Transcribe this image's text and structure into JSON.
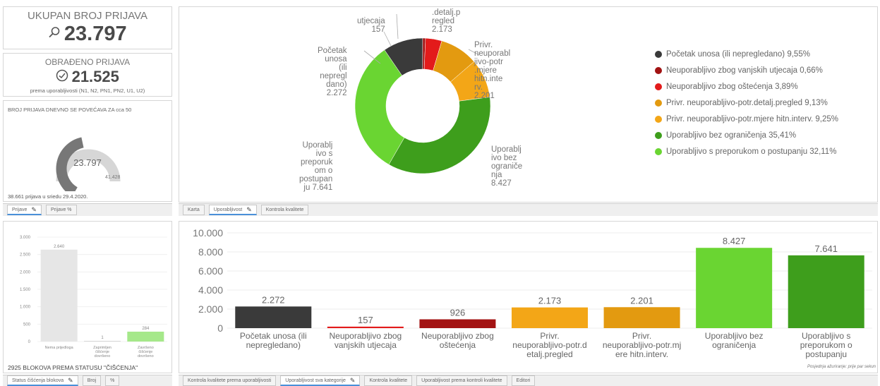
{
  "kpi_total": {
    "title": "UKUPAN BROJ PRIJAVA",
    "value": "23.797",
    "icon": "search-icon"
  },
  "kpi_processed": {
    "title": "OBRAĐENO PRIJAVA",
    "value": "21.525",
    "subtitle": "prema uporabljivosti (N1, N2, PN1, PN2, U1, U2)",
    "icon": "check-circle-icon"
  },
  "gauge": {
    "title": "BROJ PRIJAVA DNEVNO SE POVEĆAVA ZA cca 50",
    "value": "23.797",
    "min": "0",
    "max": "41.428",
    "fraction": 0.574,
    "footer": "38.661 prijava u sriedu 29.4.2020."
  },
  "tabs_left_top": [
    "Prijave",
    "Prijave %"
  ],
  "tabs_mid_top": [
    "Karta",
    "Uporabljivost",
    "Kontrola kvalitete"
  ],
  "tabs_left_bottom": [
    "Status čišćenja blokova",
    "Broj",
    "%"
  ],
  "tabs_bottom": [
    "Kontrola kvalitete prema uporabljivosti",
    "Uporabljivost sva kategorije",
    "Kontrola kvalitete",
    "Uporabljivost prema kontroli kvalitete",
    "Editori"
  ],
  "donut_labels": {
    "a": "utjecaja\n157",
    "b": ".detalj.p\nregled\n2.173",
    "c": "Početak\nunosa\n(ili\nnepregl\ndano)\n2.272",
    "d": "Privr.\nneuporabl\njivo-potr\n.mjere\nhitn.inte\nrv.\n2.201",
    "e": "Uporablj\nivo s\npreporuk\nom o\npostupan\nju 7.641",
    "f": "Uporablj\nivo bez\nograniče\nnja\n8.427"
  },
  "legend": [
    {
      "label": "Početak unosa (ili nepregledano) 9,55%",
      "color": "#3a3a3a"
    },
    {
      "label": "Neuporabljivo zbog vanjskih utjecaja 0,66%",
      "color": "#a11212"
    },
    {
      "label": "Neuporabljivo zbog oštećenja 3,89%",
      "color": "#e31b1b"
    },
    {
      "label": "Privr. neuporabljivo-potr.detalj.pregled 9,13%",
      "color": "#e39a10"
    },
    {
      "label": "Privr. neuporabljivo-potr.mjere hitn.interv. 9,25%",
      "color": "#f3a617"
    },
    {
      "label": "Uporabljivo bez ograničenja 35,41%",
      "color": "#3e9e1c"
    },
    {
      "label": "Uporabljivo s preporukom o postupanju 32,11%",
      "color": "#6ad532"
    }
  ],
  "small_chart_title": "2925 BLOKOVA PREMA STATUSU \"ČIŠĆENJA\"",
  "footnote": "Posjednja ažuriranje: prije par sekun",
  "chart_data": [
    {
      "type": "pie",
      "categories": [
        "Početak unosa (ili nepregledano)",
        "Neuporabljivo zbog vanjskih utjecaja",
        "Neuporabljivo zbog oštećenja",
        "Privr. neuporabljivo-potr.detalj.pregled",
        "Privr. neuporabljivo-potr.mjere hitn.interv.",
        "Uporabljivo bez ograničenja",
        "Uporabljivo s preporukom o postupanju"
      ],
      "values": [
        2272,
        157,
        926,
        2173,
        2201,
        8427,
        7641
      ],
      "colors": [
        "#3a3a3a",
        "#a11212",
        "#e31b1b",
        "#e39a10",
        "#f3a617",
        "#3e9e1c",
        "#6ad532"
      ]
    },
    {
      "type": "bar",
      "categories": [
        "Početak unosa (ili\nnepregledano)",
        "Neuporabljivo zbog\nvanjskih utjecaja",
        "Neuporabljivo zbog\noštećenja",
        "Privr.\nneuporabljivo-potr.d\netalj.pregled",
        "Privr.\nneuporabljivo-potr.mj\nere hitn.interv.",
        "Uporabljivo bez\nograničenja",
        "Uporabljivo s\npreporukom o\npostupanju"
      ],
      "values": [
        2272,
        157,
        926,
        2173,
        2201,
        8427,
        7641
      ],
      "value_labels": [
        "2.272",
        "157",
        "926",
        "2.173",
        "2.201",
        "8.427",
        "7.641"
      ],
      "colors": [
        "#3a3a3a",
        "#e31b1b",
        "#a31313",
        "#f3a617",
        "#e39a10",
        "#6ad532",
        "#3e9e1c"
      ],
      "ylim": [
        0,
        10000
      ],
      "yticks": [
        "0",
        "2.000",
        "4.000",
        "6.000",
        "8.000",
        "10.000"
      ],
      "grid": true
    },
    {
      "type": "bar",
      "categories": [
        "Nema prijedloga",
        "Zaprimljen\nčišćenje\ndovršeno",
        "Završeno\nčišćenje\ndovršeno"
      ],
      "values": [
        2640,
        1,
        284
      ],
      "value_labels": [
        "2.640",
        "1",
        "284"
      ],
      "colors": [
        "#e6e6e6",
        "#d8d8d8",
        "#a5e88a"
      ],
      "ylim": [
        0,
        3000
      ],
      "yticks": [
        "0",
        "500",
        "1.000",
        "1.500",
        "2.000",
        "2.500",
        "3.000"
      ]
    }
  ]
}
